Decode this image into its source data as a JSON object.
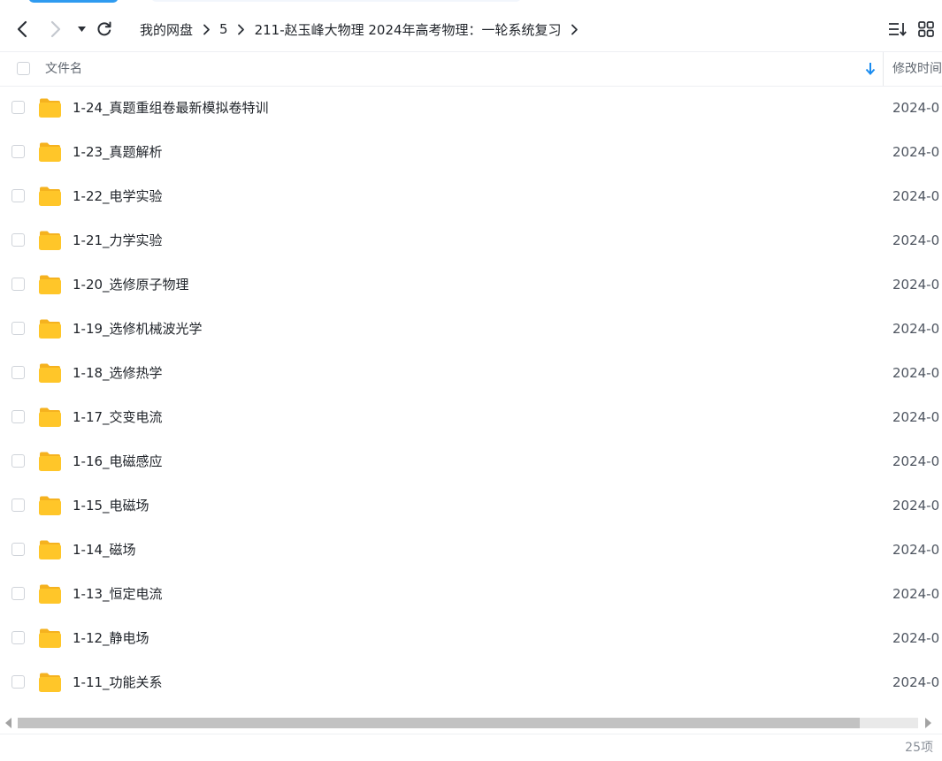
{
  "nav": {
    "breadcrumb": [
      "我的网盘",
      "5",
      "211-赵玉峰大物理 2024年高考物理：一轮系统复习"
    ]
  },
  "header": {
    "name_label": "文件名",
    "modified_label": "修改时间"
  },
  "files": [
    {
      "name": "1-24_真题重组卷最新模拟卷特训",
      "date": "2024-0"
    },
    {
      "name": "1-23_真题解析",
      "date": "2024-0"
    },
    {
      "name": "1-22_电学实验",
      "date": "2024-0"
    },
    {
      "name": "1-21_力学实验",
      "date": "2024-0"
    },
    {
      "name": "1-20_选修原子物理",
      "date": "2024-0"
    },
    {
      "name": "1-19_选修机械波光学",
      "date": "2024-0"
    },
    {
      "name": "1-18_选修热学",
      "date": "2024-0"
    },
    {
      "name": "1-17_交变电流",
      "date": "2024-0"
    },
    {
      "name": "1-16_电磁感应",
      "date": "2024-0"
    },
    {
      "name": "1-15_电磁场",
      "date": "2024-0"
    },
    {
      "name": "1-14_磁场",
      "date": "2024-0"
    },
    {
      "name": "1-13_恒定电流",
      "date": "2024-0"
    },
    {
      "name": "1-12_静电场",
      "date": "2024-0"
    },
    {
      "name": "1-11_功能关系",
      "date": "2024-0"
    }
  ],
  "footer": {
    "count": "25项"
  },
  "icons": {
    "back": "chevron-left-icon",
    "forward": "chevron-right-icon",
    "history": "caret-down-icon",
    "refresh": "refresh-icon",
    "sort": "sort-list-icon",
    "grid": "grid-view-icon",
    "folder": "folder-icon"
  },
  "colors": {
    "accent": "#1a8cf0",
    "folder": "#ffc629"
  }
}
